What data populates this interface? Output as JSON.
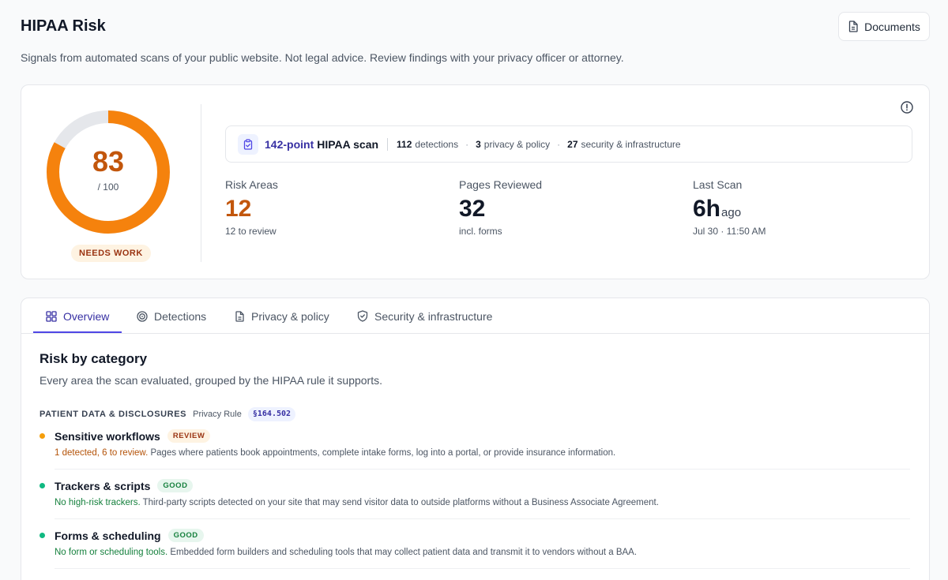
{
  "header": {
    "title": "HIPAA Risk",
    "documents_label": "Documents",
    "subtitle": "Signals from automated scans of your public website. Not legal advice. Review findings with your privacy officer or attorney."
  },
  "score": {
    "value": "83",
    "out_of": "/ 100",
    "fraction": 0.83,
    "status": "NEEDS WORK",
    "color": "#f5820d",
    "track_color": "#e5e7eb"
  },
  "scan": {
    "points": "142-point",
    "label": "HIPAA scan",
    "detections_num": "112",
    "detections_txt": "detections",
    "privacy_num": "3",
    "privacy_txt": "privacy & policy",
    "security_num": "27",
    "security_txt": "security & infrastructure"
  },
  "stats": {
    "risk": {
      "label": "Risk Areas",
      "value": "12",
      "sub": "12 to review"
    },
    "pages": {
      "label": "Pages Reviewed",
      "value": "32",
      "sub": "incl. forms"
    },
    "last": {
      "label": "Last Scan",
      "value": "6h",
      "unit": "ago",
      "sub": "Jul 30 · 11:50 AM"
    }
  },
  "tabs": [
    {
      "label": "Overview",
      "icon": "grid-icon",
      "active": true
    },
    {
      "label": "Detections",
      "icon": "target-icon",
      "active": false
    },
    {
      "label": "Privacy & policy",
      "icon": "document-icon",
      "active": false
    },
    {
      "label": "Security & infrastructure",
      "icon": "shield-icon",
      "active": false
    }
  ],
  "section": {
    "title": "Risk by category",
    "subtitle": "Every area the scan evaluated, grouped by the HIPAA rule it supports.",
    "group": {
      "title": "PATIENT DATA & DISCLOSURES",
      "rule": "Privacy Rule",
      "code": "§164.502"
    },
    "items": [
      {
        "title": "Sensitive workflows",
        "badge": "REVIEW",
        "status": "review",
        "dot_color": "#f59e0b",
        "highlight": "1 detected, 6 to review.",
        "description": "Pages where patients book appointments, complete intake forms, log into a portal, or provide insurance information."
      },
      {
        "title": "Trackers & scripts",
        "badge": "GOOD",
        "status": "good",
        "dot_color": "#10b981",
        "highlight": "No high-risk trackers.",
        "description": "Third-party scripts detected on your site that may send visitor data to outside platforms without a Business Associate Agreement."
      },
      {
        "title": "Forms & scheduling",
        "badge": "GOOD",
        "status": "good",
        "dot_color": "#10b981",
        "highlight": "No form or scheduling tools.",
        "description": "Embedded form builders and scheduling tools that may collect patient data and transmit it to vendors without a BAA."
      }
    ]
  }
}
